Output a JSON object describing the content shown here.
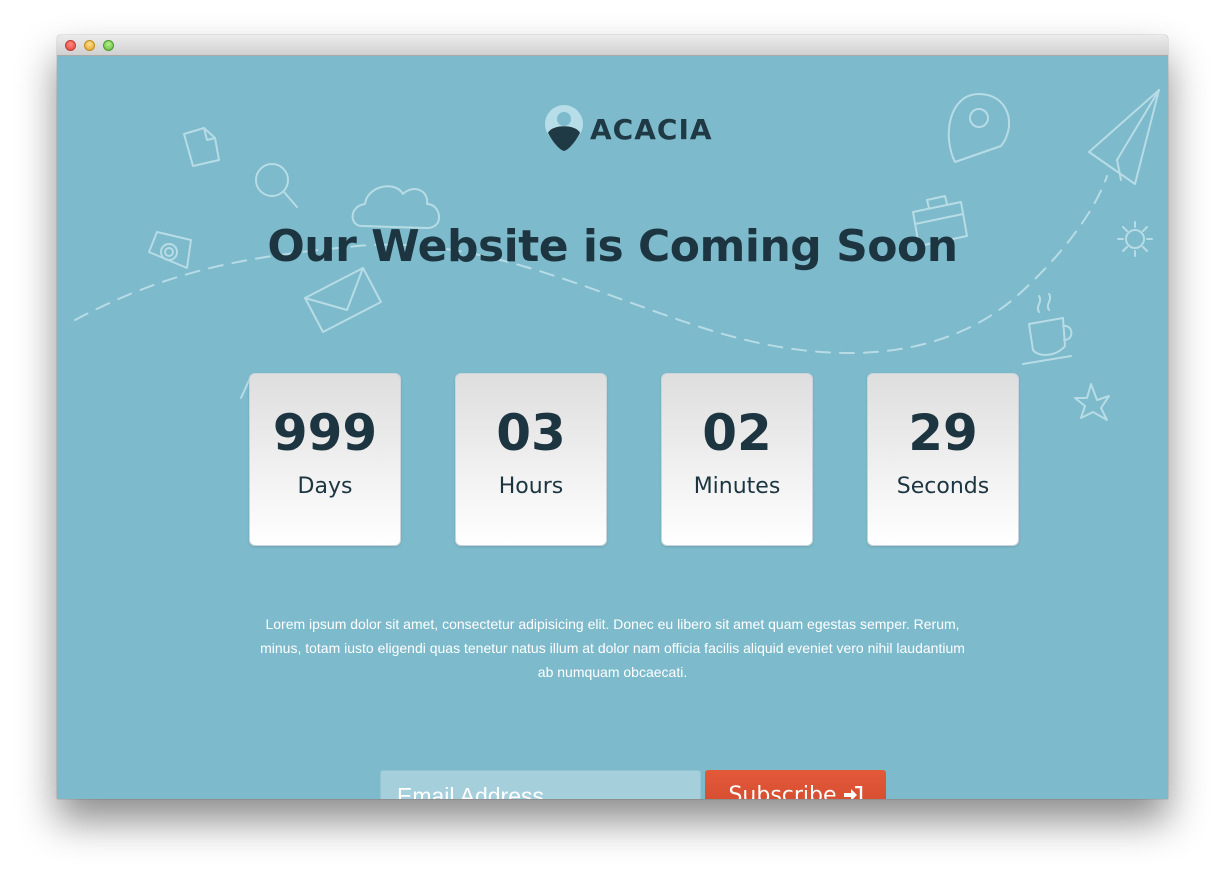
{
  "brand": {
    "name": "ACACIA"
  },
  "headline": "Our Website is Coming Soon",
  "countdown": [
    {
      "value": "999",
      "label": "Days"
    },
    {
      "value": "03",
      "label": "Hours"
    },
    {
      "value": "02",
      "label": "Minutes"
    },
    {
      "value": "29",
      "label": "Seconds"
    }
  ],
  "description": "Lorem ipsum dolor sit amet, consectetur adipisicing elit. Donec eu libero sit amet quam egestas semper. Rerum, minus, totam iusto eligendi quas tenetur natus illum at dolor nam officia facilis aliquid eveniet vero nihil laudantium ab numquam obcaecati.",
  "subscribe": {
    "email_placeholder": "Email Address",
    "button_label": "Subscribe",
    "button_icon": "sign-in-icon"
  },
  "colors": {
    "background": "#7dbacb",
    "heading": "#1c3540",
    "button": "#d9502f",
    "input": "#a5cfdb"
  },
  "window_controls": [
    "close",
    "minimize",
    "zoom"
  ]
}
